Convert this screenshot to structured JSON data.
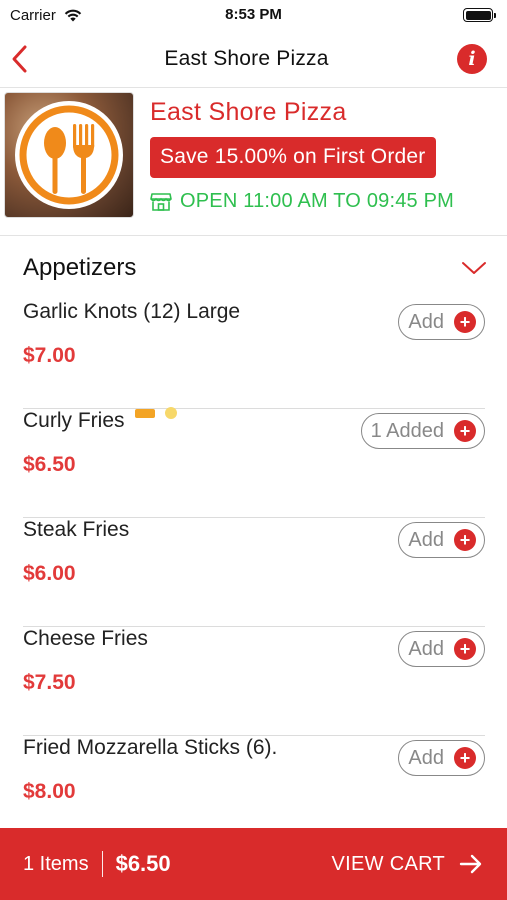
{
  "status_bar": {
    "carrier": "Carrier",
    "time": "8:53 PM"
  },
  "nav": {
    "title": "East Shore Pizza"
  },
  "restaurant": {
    "name": "East Shore Pizza",
    "offer": "Save 15.00% on First Order",
    "hours": "OPEN 11:00 AM TO 09:45 PM"
  },
  "section": {
    "title": "Appetizers"
  },
  "items": [
    {
      "name": "Garlic Knots (12) Large",
      "price": "$7.00",
      "button": "Add"
    },
    {
      "name": "Curly Fries",
      "price": "$6.50",
      "button": "1 Added"
    },
    {
      "name": "Steak Fries",
      "price": "$6.00",
      "button": "Add"
    },
    {
      "name": "Cheese Fries",
      "price": "$7.50",
      "button": "Add"
    },
    {
      "name": "Fried Mozzarella Sticks (6).",
      "price": "$8.00",
      "button": "Add"
    }
  ],
  "cart": {
    "items": "1 Items",
    "total": "$6.50",
    "action": "VIEW CART"
  },
  "colors": {
    "accent": "#d92b2b",
    "open": "#2fbf4f",
    "price": "#e23a3a"
  },
  "icons": {
    "back": "chevron-left-icon",
    "info": "info-icon",
    "store": "store-icon",
    "collapse": "chevron-down-icon",
    "add": "plus-circle-icon",
    "cart_arrow": "arrow-right-icon"
  }
}
